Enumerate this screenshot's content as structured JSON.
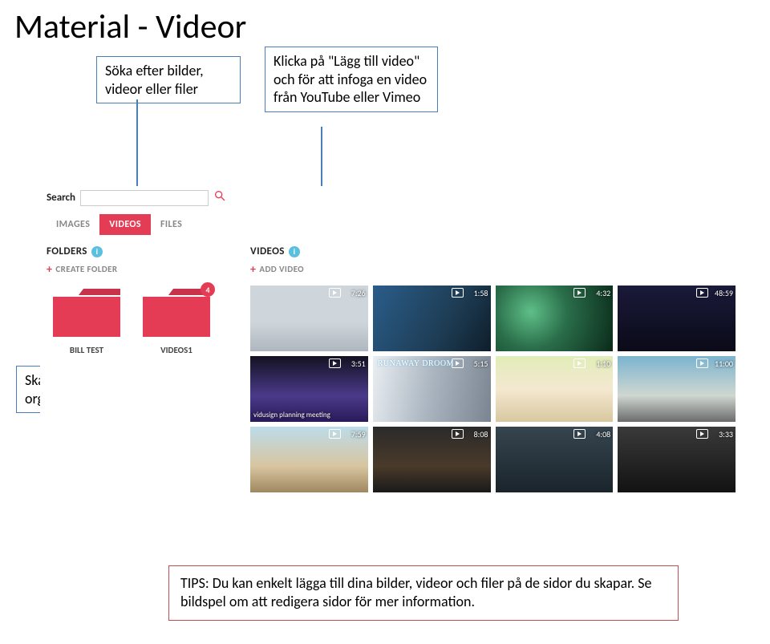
{
  "title": "Material - Videor",
  "callouts": {
    "search": "Söka efter bilder,\nvideor eller filer",
    "addvideo": "Klicka på \"Lägg till video\" och för att infoga en video från YouTube eller Vimeo",
    "folders": "Skapa mappar för att organisera dina videor"
  },
  "app": {
    "search_label": "Search",
    "search_placeholder": "",
    "tabs": {
      "images": "IMAGES",
      "videos": "VIDEOS",
      "files": "FILES"
    },
    "folders_section": "FOLDERS",
    "create_folder": "CREATE FOLDER",
    "videos_section": "VIDEOS",
    "add_video": "ADD VIDEO",
    "folders": [
      {
        "label": "BILL TEST",
        "badge": ""
      },
      {
        "label": "VIDEOS1",
        "badge": "4"
      }
    ],
    "thumbs": [
      {
        "time": "7:26",
        "cls": "bg1",
        "title": ""
      },
      {
        "time": "1:58",
        "cls": "bg2",
        "title": ""
      },
      {
        "time": "4:32",
        "cls": "bg3",
        "title": ""
      },
      {
        "time": "48:59",
        "cls": "bg4",
        "title": ""
      },
      {
        "time": "3:51",
        "cls": "bg5",
        "title": "vidusign planning meeting"
      },
      {
        "time": "5:15",
        "cls": "bg6",
        "title": "",
        "overlay": "RUNAWAY DROOM"
      },
      {
        "time": "1:10",
        "cls": "bg7",
        "title": ""
      },
      {
        "time": "11:00",
        "cls": "bg8",
        "title": ""
      },
      {
        "time": "7:59",
        "cls": "bg9",
        "title": ""
      },
      {
        "time": "8:08",
        "cls": "bg10",
        "title": ""
      },
      {
        "time": "4:08",
        "cls": "bg11",
        "title": ""
      },
      {
        "time": "3:33",
        "cls": "bg12",
        "title": ""
      }
    ]
  },
  "tips": "TIPS: Du kan enkelt lägga till dina bilder, videor och filer på de sidor du skapar. Se bildspel om att redigera sidor för mer information."
}
